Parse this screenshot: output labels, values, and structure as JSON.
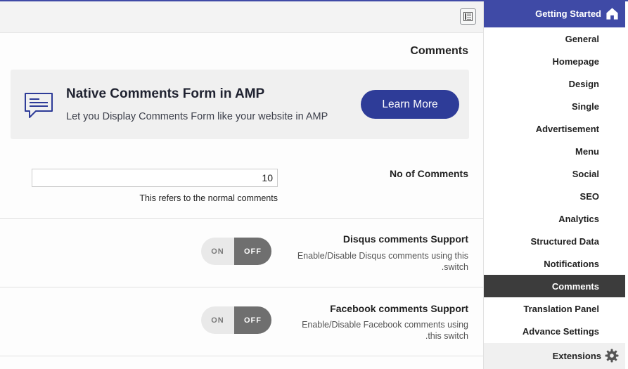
{
  "main": {
    "section_title": "Comments",
    "promo": {
      "title": "Native Comments Form in AMP",
      "description": "Let you Display Comments Form like your website in AMP",
      "button_label": "Learn More",
      "icon": "comment-form-icon"
    },
    "no_of_comments": {
      "label": "No of Comments",
      "value": "10",
      "help": "This refers to the normal comments"
    },
    "disqus": {
      "label": "Disqus comments Support",
      "description_line1": "Enable/Disable Disqus comments using this",
      "description_line2": ".switch",
      "toggle_on": "ON",
      "toggle_off": "OFF",
      "state": "off"
    },
    "facebook": {
      "label": "Facebook comments Support",
      "description_line1": "Enable/Disable Facebook comments using",
      "description_line2": ".this switch",
      "toggle_on": "ON",
      "toggle_off": "OFF",
      "state": "off"
    }
  },
  "sidebar": {
    "header": {
      "label": "Getting Started",
      "icon": "home-icon"
    },
    "items": [
      {
        "label": "General"
      },
      {
        "label": "Homepage"
      },
      {
        "label": "Design"
      },
      {
        "label": "Single"
      },
      {
        "label": "Advertisement"
      },
      {
        "label": "Menu"
      },
      {
        "label": "Social"
      },
      {
        "label": "SEO"
      },
      {
        "label": "Analytics"
      },
      {
        "label": "Structured Data"
      },
      {
        "label": "Notifications"
      },
      {
        "label": "Comments",
        "active": true
      },
      {
        "label": "Translation Panel"
      },
      {
        "label": "Advance Settings"
      }
    ],
    "extensions": {
      "label": "Extensions",
      "icon": "gear-icon"
    }
  },
  "colors": {
    "accent": "#3f4aa6",
    "button": "#2e3c98",
    "active_item": "#3c3c3c",
    "toggle_off": "#6f6f6f"
  }
}
